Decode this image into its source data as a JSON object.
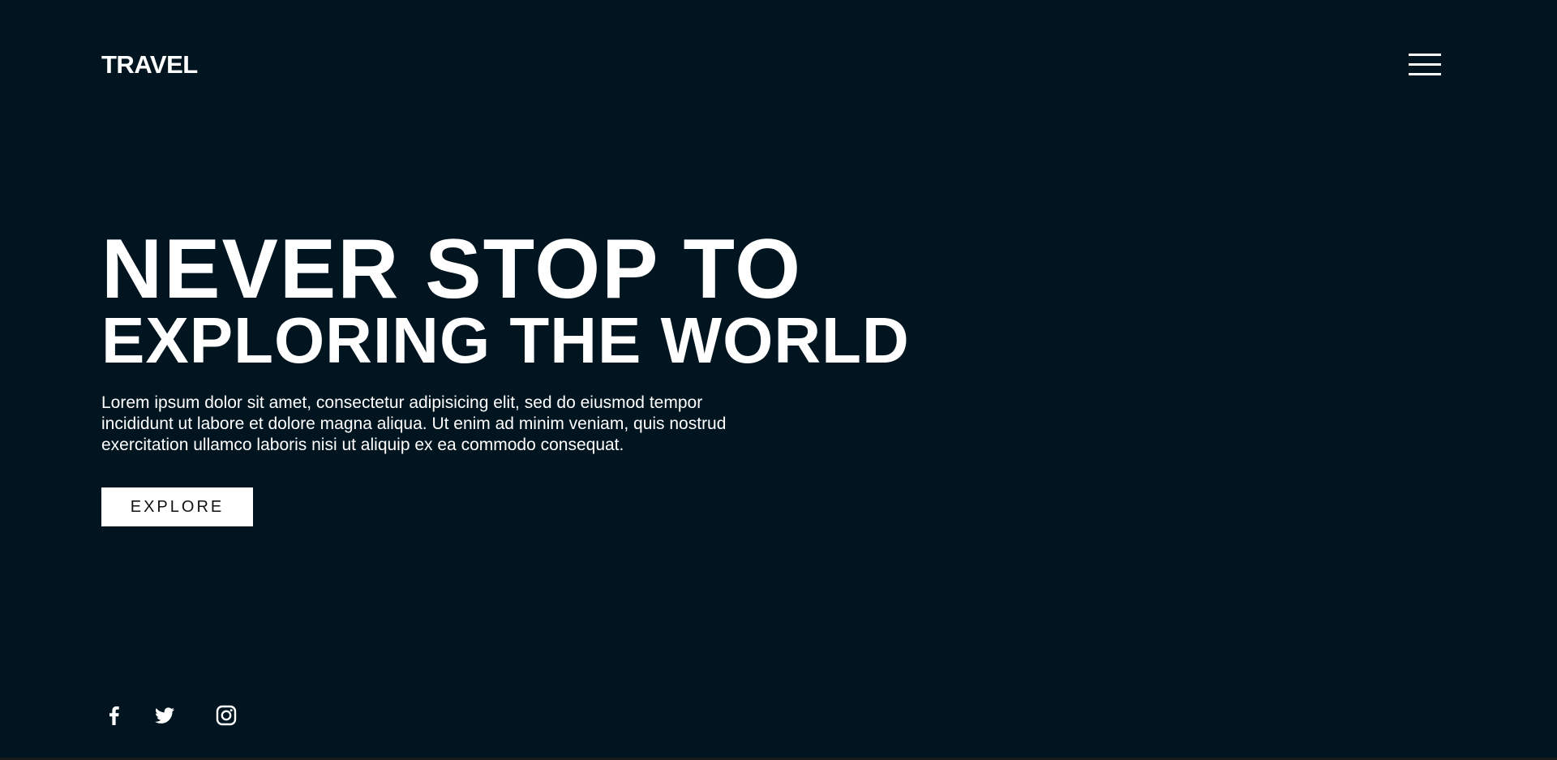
{
  "header": {
    "logo": "TRAVEL",
    "menu_icon": "hamburger-menu-icon"
  },
  "hero": {
    "title_line1": "NEVER STOP TO",
    "title_line2": "EXPLORING THE WORLD",
    "description": "Lorem ipsum dolor sit amet, consectetur adipisicing elit, sed do eiusmod tempor incididunt ut labore et dolore magna aliqua. Ut enim ad minim veniam, quis nostrud exercitation ullamco laboris nisi ut aliquip ex ea commodo consequat.",
    "button_label": "EXPLORE"
  },
  "social": {
    "icons": [
      "facebook-icon",
      "twitter-icon",
      "instagram-icon"
    ]
  },
  "colors": {
    "background": "#011520",
    "text": "#ffffff",
    "button_bg": "#ffffff",
    "button_text": "#111111"
  }
}
